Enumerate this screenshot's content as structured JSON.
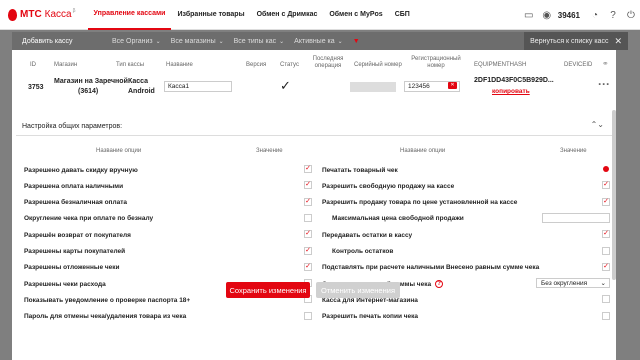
{
  "brand": {
    "name": "МТС",
    "sub": "Касса",
    "sup": "β"
  },
  "nav": [
    {
      "label": "Управление кассами",
      "active": true
    },
    {
      "label": "Избранные товары"
    },
    {
      "label": "Обмен с Дримкас"
    },
    {
      "label": "Обмен с MyPos"
    },
    {
      "label": "СБП"
    }
  ],
  "user_id": "39461",
  "filterbar": {
    "add": "Добавить кассу",
    "orgs": "Все Организ",
    "shops": "Все магазины",
    "types": "Все типы кас",
    "active": "Активные ка"
  },
  "return_label": "Вернуться к списку касс",
  "table_head": {
    "id": "ID",
    "shop": "Магазин",
    "cash_type": "Тип кассы",
    "name": "Название",
    "version": "Версия",
    "status": "Статус",
    "last_op": "Последняя операция",
    "serial": "Серийный номер",
    "reg": "Регистрационный номер",
    "equipment": "EQUIPMENTHASH",
    "device": "DEVICEID"
  },
  "row": {
    "id": "3753",
    "shop": "Магазин на Заречной",
    "shop_num": "(3614)",
    "cash_type": "Касса",
    "cash_os": "Android",
    "name": "Касса1",
    "reg": "123456",
    "hash": "2DF1DD43F0C5B929D...",
    "copy": "копировать"
  },
  "section_title": "Настройка общих параметров:",
  "col_head": {
    "name": "Название опции",
    "value": "Значение"
  },
  "left_opts": [
    {
      "label": "Разрешено давать скидку вручную",
      "checked": true
    },
    {
      "label": "Разрешена оплата наличными",
      "checked": true
    },
    {
      "label": "Разрешена безналичная оплата",
      "checked": true
    },
    {
      "label": "Округление чека при оплате по безналу",
      "checked": false
    },
    {
      "label": "Разрешён возврат от покупателя",
      "checked": true
    },
    {
      "label": "Разрешены карты покупателей",
      "checked": true
    },
    {
      "label": "Разрешены отложенные чеки",
      "checked": true
    },
    {
      "label": "Разрешены чеки расхода",
      "checked": false
    },
    {
      "label": "Показывать уведомление о проверке паспорта 18+",
      "checked": false
    },
    {
      "label": "Пароль для отмены чека/удаления товара из чека",
      "checked": false
    }
  ],
  "right_opts": [
    {
      "label": "Печатать товарный чек",
      "checked": false,
      "dot": true
    },
    {
      "label": "Разрешить свободную продажу на кассе",
      "checked": true
    },
    {
      "label": "Разрешить продажу товара по цене установленной на кассе",
      "checked": true
    },
    {
      "label": "Максимальная цена свободной продажи",
      "indent": true,
      "input": true
    },
    {
      "label": "Передавать остатки в кассу",
      "checked": true
    },
    {
      "label": "Контроль остатков",
      "indent": true,
      "checked": false
    },
    {
      "label": "Подставлять при расчете наличными Внесено равным сумме чека",
      "checked": true
    },
    {
      "label": "Округление итоговой суммы чека",
      "select": "Без округления",
      "help": true
    },
    {
      "label": "Касса для Интернет-магазина",
      "checked": false
    },
    {
      "label": "Разрешить печать копии чека",
      "checked": false
    }
  ],
  "buttons": {
    "save": "Сохранить изменения",
    "cancel": "Отменить изменения"
  },
  "colors": {
    "accent": "#e30611"
  }
}
